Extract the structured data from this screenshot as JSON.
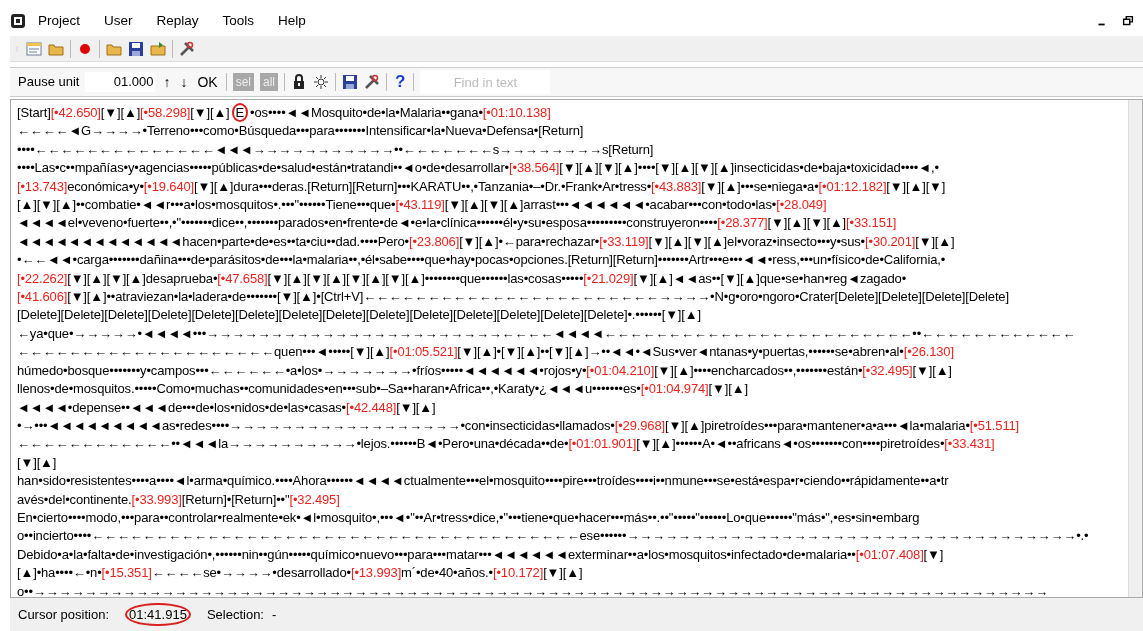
{
  "menu": [
    "Project",
    "User",
    "Replay",
    "Tools",
    "Help"
  ],
  "toolbar2": {
    "pause_label": "Pause unit",
    "pause_value": "01.000",
    "buttons": [
      {
        "label": "↑",
        "disabled": false
      },
      {
        "label": "↓",
        "disabled": false
      },
      {
        "label": "OK",
        "disabled": false
      },
      {
        "label": "sel",
        "disabled": true
      },
      {
        "label": "all",
        "disabled": true
      }
    ],
    "help": "?",
    "search": {
      "placeholder": "Find in text"
    }
  },
  "lines": [
    {
      "segments": [
        {
          "text": "[Start]",
          "kind": "plain"
        },
        {
          "text": "[•42.650]",
          "kind": "time"
        },
        {
          "text": "[▼][▲]",
          "kind": "plain"
        },
        {
          "text": "[•58.298]",
          "kind": "time"
        },
        {
          "text": "[▼][▲]",
          "kind": "plain"
        },
        {
          "text": "E",
          "kind": "plain",
          "circled": true
        },
        {
          "text": "•os••••◄◄Mosquito•de•la•Malaria••gana•",
          "kind": "plain"
        },
        {
          "text": "[•01:10.138]",
          "kind": "time"
        }
      ]
    },
    {
      "segments": [
        {
          "text": "←←←←◄G→→→→•Terreno•••como•Búsqueda•••para•••••••Intensificar•la•Nueva•Defensa•[Return]",
          "kind": "plain"
        }
      ]
    },
    {
      "segments": [
        {
          "text": "••••←←←←←←←←←←←←←←◄◄◄→→→→→→→→→→→••←←←←←←←s→→→→→→→→s[Return]",
          "kind": "plain"
        }
      ]
    },
    {
      "segments": [
        {
          "text": "••••Las•c••mpañías•y•agencias•••••públicas•de•salud•están•tratandi••◄o•de•desarrollar•",
          "kind": "plain"
        },
        {
          "text": "[•38.564]",
          "kind": "time"
        },
        {
          "text": "[▼][▲][▼][▲]••••[▼][▲][▼][▲]insecticidas•de•baja•toxicidad••••◄,•",
          "kind": "plain"
        }
      ]
    },
    {
      "segments": [
        {
          "text": "[•13.743]",
          "kind": "time"
        },
        {
          "text": "económica•y•",
          "kind": "plain"
        },
        {
          "text": "[•19.640]",
          "kind": "time"
        },
        {
          "text": "[▼][▲]dura•••deras.[Return][Return]•••KARATU••,•Tanzania•–•Dr.•Frank•Ar•tress•",
          "kind": "plain"
        },
        {
          "text": "[•43.883]",
          "kind": "time"
        },
        {
          "text": "[▼][▲]•••se•niega•a•",
          "kind": "plain"
        },
        {
          "text": "[•01:12.182]",
          "kind": "time"
        },
        {
          "text": "[▼][▲][▼]",
          "kind": "plain"
        }
      ]
    },
    {
      "segments": [
        {
          "text": "[▲][▼][▲]••combatie•◄◄r•••a•los•mosquitos•.•••\"••••••Tiene•••que•",
          "kind": "plain"
        },
        {
          "text": "[•43.119]",
          "kind": "time"
        },
        {
          "text": "[▼][▲][▼][▲]arrast•••◄◄◄◄◄◄•acabar•••con•todo•las•",
          "kind": "plain"
        },
        {
          "text": "[•28.049]",
          "kind": "time"
        }
      ]
    },
    {
      "segments": [
        {
          "text": "◄◄◄◄el•veveno•fuerte••,•\"•••••••dice••,•••••••parados•en•frente•de◄•e•la•clínica••••••él•y•su•esposa•••••••••construyeron••••",
          "kind": "plain"
        },
        {
          "text": "[•28.377]",
          "kind": "time"
        },
        {
          "text": "[▼][▲][▼][▲]",
          "kind": "plain"
        },
        {
          "text": "[•33.151]",
          "kind": "time"
        }
      ]
    },
    {
      "segments": [
        {
          "text": "◄◄◄◄◄◄◄◄◄◄◄◄◄hacen•parte•de•es••ta•ciu••dad.••••Pero•",
          "kind": "plain"
        },
        {
          "text": "[•23.806]",
          "kind": "time"
        },
        {
          "text": "[▼][▲]•←para•rechazar•",
          "kind": "plain"
        },
        {
          "text": "[•33.119]",
          "kind": "time"
        },
        {
          "text": "[▼][▲][▼][▲]el•voraz•insecto•••y•sus•",
          "kind": "plain"
        },
        {
          "text": "[•30.201]",
          "kind": "time"
        },
        {
          "text": "[▼][▲]",
          "kind": "plain"
        }
      ]
    },
    {
      "segments": [
        {
          "text": "•←←◄◄•carga•••••••dañina•••de•parásitos•de•••la•malaria••,•él•sabe••••que•hay•pocas•opciones.[Return][Return]•••••••Artr•••e•••◄◄•ress,•••un•físico•de•California,•",
          "kind": "plain"
        }
      ]
    },
    {
      "segments": [
        {
          "text": "[•22.262]",
          "kind": "time"
        },
        {
          "text": "[▼][▲][▼][▲]desaprueba•",
          "kind": "plain"
        },
        {
          "text": "[•47.658]",
          "kind": "time"
        },
        {
          "text": "[▼][▲][▼][▲][▼][▲][▼][▲]••••••••que••••••las•cosas•••••",
          "kind": "plain"
        },
        {
          "text": "[•21.029]",
          "kind": "time"
        },
        {
          "text": "[▼][▲]◄◄as••[▼][▲]que•se•han•reg◄zagado•",
          "kind": "plain"
        }
      ]
    },
    {
      "segments": [
        {
          "text": "[•41.606]",
          "kind": "time"
        },
        {
          "text": "[▼][▲]••atraviezan•la•ladera•de•••••••[▼][▲]•[Ctrl+V]←←←←←←←←←←←←←←←←←←←←←←←→→→→•N•g•oro•ngoro•Crater[Delete][Delete][Delete][Delete]",
          "kind": "plain"
        }
      ]
    },
    {
      "segments": [
        {
          "text": "[Delete][Delete][Delete][Delete][Delete][Delete][Delete][Delete][Delete][Delete][Delete][Delete][Delete][Delete]•.••••••[▼][▲]",
          "kind": "plain"
        }
      ]
    },
    {
      "segments": [
        {
          "text": "←ya•que•→→→→→•◄◄◄◄•••→→→→→→→→→→→→→→→→→→→→→→→←←←←◄◄◄◄←←←←←←←←←←←←←←←←←←←←←←←←••←←←←←←←←←←←←",
          "kind": "plain"
        }
      ]
    },
    {
      "segments": [
        {
          "text": "←←←←←←←←←←←←←←←←←←←←quen•••◄•••••[▼][▲]",
          "kind": "plain"
        },
        {
          "text": "[•01:05.521]",
          "kind": "time"
        },
        {
          "text": "[▼][▲]•[▼][▲]••[▼][▲]→••◄◄•◄Sus•ver◄ntanas•y•puertas,••••••se•abren•al•",
          "kind": "plain"
        },
        {
          "text": "[•26.130]",
          "kind": "time"
        }
      ]
    },
    {
      "segments": [
        {
          "text": "húmedo•bosque•••••••y•campos•••←←←←←←•a•los•→→→→→→→•fríos•••••◄◄◄◄◄◄•rojos•y•",
          "kind": "plain"
        },
        {
          "text": "[•01:04.210]",
          "kind": "time"
        },
        {
          "text": "[▼][▲]••••encharcados••,•••••••están•",
          "kind": "plain"
        },
        {
          "text": "[•32.495]",
          "kind": "time"
        },
        {
          "text": "[▼][▲]",
          "kind": "plain"
        }
      ]
    },
    {
      "segments": [
        {
          "text": "llenos•de•mosquitos.•••••Como•muchas••comunidades•en•••sub•–Sa••haran•Africa••,•Karaty•¿◄◄◄u•••••••es•",
          "kind": "plain"
        },
        {
          "text": "[•01:04.974]",
          "kind": "time"
        },
        {
          "text": "[▼][▲]",
          "kind": "plain"
        }
      ]
    },
    {
      "segments": [
        {
          "text": "◄◄◄◄•depense••◄◄◄de•••de•los•nidos•de•las•casas•",
          "kind": "plain"
        },
        {
          "text": "[•42.448]",
          "kind": "time"
        },
        {
          "text": "[▼][▲]",
          "kind": "plain"
        }
      ]
    },
    {
      "segments": [
        {
          "text": "•→•••◄◄◄◄◄◄◄◄◄as•redes••••→→→→→→→→→→→→→→→→→→•con•insecticidas•llamados•",
          "kind": "plain"
        },
        {
          "text": "[•29.968]",
          "kind": "time"
        },
        {
          "text": "[▼][▲]piretroídes•••para•mantener•a•a•••◄la•malaria•",
          "kind": "plain"
        },
        {
          "text": "[•51.511]",
          "kind": "time"
        }
      ]
    },
    {
      "segments": [
        {
          "text": "←←←←←←←←←←←←••◄◄◄la→→→→→→→→→→•lejos.••••••B◄•Pero•una•década••de•",
          "kind": "plain"
        },
        {
          "text": "[•01:01.901]",
          "kind": "time"
        },
        {
          "text": "[▼][▲]••••••A•◄••africans◄•os•••••••con••••piretroídes•",
          "kind": "plain"
        },
        {
          "text": "[•33.431]",
          "kind": "time"
        }
      ]
    },
    {
      "segments": [
        {
          "text": "[▼][▲]",
          "kind": "plain"
        }
      ]
    },
    {
      "segments": [
        {
          "text": "han•sido•resistentes••••a••••◄l•arma•químico.••••Ahora••••••◄◄◄◄ctualmente•••el•mosquito••••pire•••troídes••••i••nmune•••se•está•espa•r•ciendo••rápidamente••a•tr",
          "kind": "plain"
        }
      ]
    },
    {
      "segments": [
        {
          "text": "avés•del•continente.",
          "kind": "plain"
        },
        {
          "text": "[•33.993]",
          "kind": "time"
        },
        {
          "text": "[Return]•[Return]••\"",
          "kind": "plain"
        },
        {
          "text": "[•32.495]",
          "kind": "time"
        }
      ]
    },
    {
      "segments": [
        {
          "text": "En•cierto••••modo,•••para••controlar•realmente•ek•◄l•mosquito•,•••◄•\"••Ar•tress•dice,•\"•••tiene•que•hacer•••más••.••\"•••••\"••••••Lo•que••••••\"más•\",•es•sin•embarg",
          "kind": "plain"
        }
      ]
    },
    {
      "segments": [
        {
          "text": "o••incierto••••←←←←←←←←←←←←←←←←←←←←←←←←←←←←←←←←←←←←←←ese••••••→→→→→→→→→→→→→→→→→→→→→→→→→→→→→→→→→→→•.•",
          "kind": "plain"
        }
      ]
    },
    {
      "segments": [
        {
          "text": "Debido•a•la•falta•de•investigación•,••••••nin••gún•••••químico•nuevo•••para•••matar•••◄◄◄◄◄◄exterminar••a•los•mosquitos•infectado•de•malaria••",
          "kind": "plain"
        },
        {
          "text": "[•01:07.408]",
          "kind": "time"
        },
        {
          "text": "[▼]",
          "kind": "plain"
        }
      ]
    },
    {
      "segments": [
        {
          "text": "[▲]•ha••••←•n•",
          "kind": "plain"
        },
        {
          "text": "[•15.351]",
          "kind": "time"
        },
        {
          "text": "←←←←se•→→→→•desarrollado•",
          "kind": "plain"
        },
        {
          "text": "[•13.993]",
          "kind": "time"
        },
        {
          "text": "m´•de•40•años.•",
          "kind": "plain"
        },
        {
          "text": "[•10.172]",
          "kind": "time"
        },
        {
          "text": "[▼][▲]",
          "kind": "plain"
        }
      ]
    },
    {
      "segments": [
        {
          "text": "o••→→→→→→→→→→→→→→→→→→→→→→→→→→→→→→→→→→→→→→→→→→→→→→→→→→→→→→→→→→→→→→→→→→→→→→→→→→→→→→→",
          "kind": "plain"
        }
      ]
    }
  ],
  "status": {
    "cursor_label": "Cursor position:",
    "cursor_value": "01:41.915",
    "cursor_circled": true,
    "selection_label": "Selection:",
    "selection_value": "-"
  }
}
